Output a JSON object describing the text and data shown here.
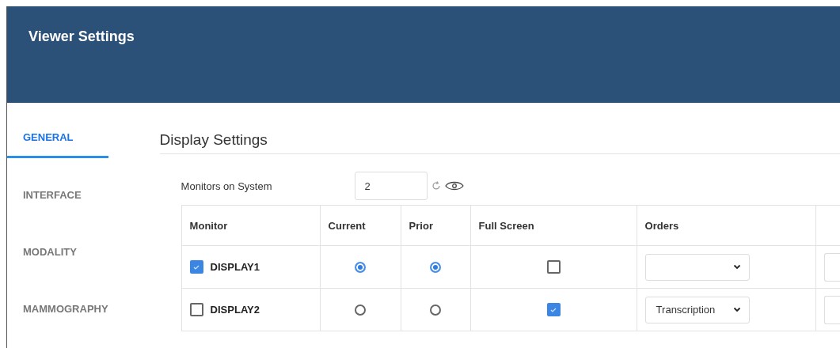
{
  "window": {
    "title": "Viewer Settings"
  },
  "tabs": [
    {
      "label": "GENERAL",
      "selected": true
    },
    {
      "label": "INTERFACE",
      "selected": false
    },
    {
      "label": "MODALITY",
      "selected": false
    },
    {
      "label": "MAMMOGRAPHY",
      "selected": false
    }
  ],
  "section": {
    "title": "Display Settings"
  },
  "monitors_field": {
    "label": "Monitors on System",
    "value": "2"
  },
  "table": {
    "columns": [
      "Monitor",
      "Current",
      "Prior",
      "Full Screen",
      "Orders"
    ],
    "rows": [
      {
        "monitor": "DISPLAY1",
        "checked": true,
        "current": true,
        "prior": true,
        "full_screen": false,
        "orders": ""
      },
      {
        "monitor": "DISPLAY2",
        "checked": false,
        "current": false,
        "prior": false,
        "full_screen": true,
        "orders": "Transcription"
      }
    ]
  }
}
